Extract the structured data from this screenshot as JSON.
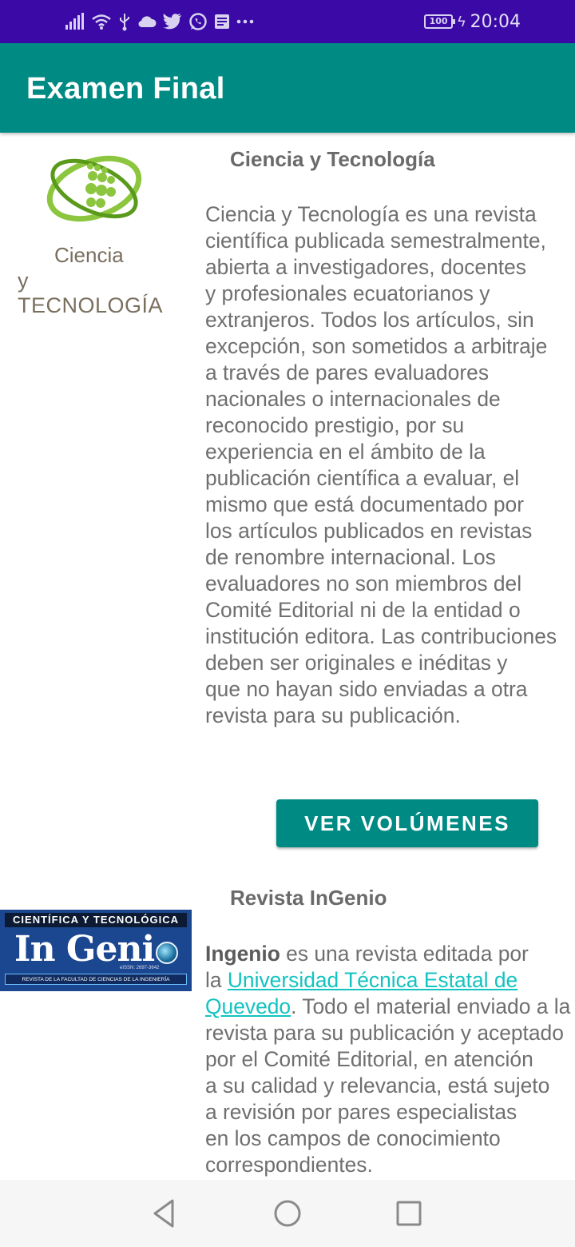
{
  "status_bar": {
    "time": "20:04",
    "battery": "100",
    "icons": [
      "signal-icon",
      "wifi-icon",
      "usb-icon",
      "cloud-icon",
      "twitter-icon",
      "whatsapp-icon",
      "message-icon",
      "more-icon",
      "battery-icon",
      "charging-icon"
    ]
  },
  "app_bar": {
    "title": "Examen Final",
    "background": "#008a84"
  },
  "journals": [
    {
      "logo": {
        "line1": "Ciencia",
        "line2": "y TECNOLOGÍA"
      },
      "title": "Ciencia y Tecnología",
      "description_lines": [
        "Ciencia y Tecnología es una revista",
        "científica publicada semestralmente,",
        "abierta a investigadores, docentes",
        "y profesionales ecuatorianos y",
        "extranjeros. Todos los artículos, sin",
        "excepción, son sometidos a arbitraje",
        "a través de pares evaluadores",
        "nacionales o internacionales de",
        "reconocido prestigio, por su",
        "experiencia en el ámbito de la",
        "publicación científica a evaluar, el",
        "mismo que está documentado por",
        "los artículos publicados en revistas",
        "de renombre internacional. Los",
        "evaluadores no son miembros del",
        "Comité Editorial ni de la entidad o",
        "institución editora. Las contribuciones",
        "deben ser originales e inéditas y",
        "que no hayan sido enviadas a otra",
        "revista para su publicación."
      ],
      "button_label": "VER VOLÚMENES"
    },
    {
      "logo": {
        "top": "CIENTÍFICA Y TECNOLÓGICA",
        "main": "In Geni",
        "issn": "eISSN: 2697-3642",
        "bottom": "REVISTA DE LA FACULTAD DE CIENCIAS DE LA INGENIERÍA"
      },
      "title": "Revista InGenio",
      "desc_bold": "Ingenio",
      "desc_after_bold": " es una revista editada por",
      "desc_line2_prefix": "la ",
      "link_part1": "Universidad Técnica Estatal de",
      "link_part2": "Quevedo",
      "desc_after_link": ". Todo el material enviado a la",
      "description_lines": [
        "revista para su publicación y aceptado",
        "por el Comité Editorial, en atención",
        "a su calidad y relevancia, está sujeto",
        "a revisión por pares especialistas",
        "en los campos de conocimiento",
        "correspondientes."
      ],
      "link_color": "#13c3c1"
    }
  ],
  "nav_bar": {
    "buttons": [
      "back-icon",
      "home-icon",
      "recent-apps-icon"
    ]
  }
}
